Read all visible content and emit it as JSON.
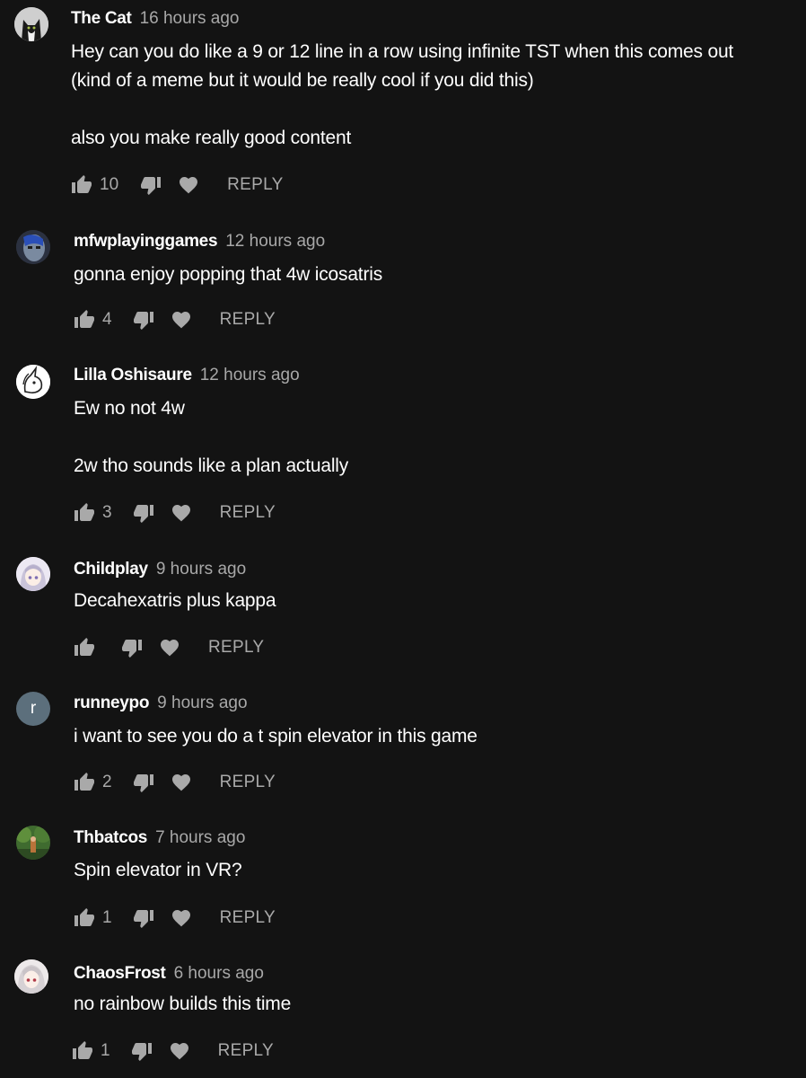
{
  "comments": [
    {
      "author": "The Cat",
      "time": "16 hours ago",
      "lines": [
        "Hey can you do like a 9 or 12 line in a row using infinite TST when this comes out",
        "(kind of a meme but it would be really cool if you did this)",
        "",
        "also you make really good content"
      ],
      "likes": "10",
      "reply": "REPLY",
      "avatar": "black-white-cat"
    },
    {
      "author": "mfwplayinggames",
      "time": "12 hours ago",
      "lines": [
        "gonna enjoy popping that 4w icosatris"
      ],
      "likes": "4",
      "reply": "REPLY",
      "avatar": "blue-face"
    },
    {
      "author": "Lilla Oshisaure",
      "time": "12 hours ago",
      "lines": [
        "Ew no not 4w",
        "",
        "2w tho sounds like a plan actually"
      ],
      "likes": "3",
      "reply": "REPLY",
      "avatar": "line-drawing-unicorn"
    },
    {
      "author": "Childplay",
      "time": "9 hours ago",
      "lines": [
        "Decahexatris plus kappa"
      ],
      "likes": "",
      "reply": "REPLY",
      "avatar": "anime-girl-silver-hair"
    },
    {
      "author": "runneypo",
      "time": "9 hours ago",
      "lines": [
        "i want to see you do a t spin elevator in this game"
      ],
      "likes": "2",
      "reply": "REPLY",
      "avatar": "letter",
      "avatar_letter": "r"
    },
    {
      "author": "Thbatcos",
      "time": "7 hours ago",
      "lines": [
        "Spin elevator in VR?"
      ],
      "likes": "1",
      "reply": "REPLY",
      "avatar": "forest-photo"
    },
    {
      "author": "ChaosFrost",
      "time": "6 hours ago",
      "lines": [
        "no rainbow builds this time"
      ],
      "likes": "1",
      "reply": "REPLY",
      "avatar": "anime-girl-white-hair"
    }
  ],
  "icons": {
    "like": "thumb-up-icon",
    "dislike": "thumb-down-icon",
    "heart": "heart-icon"
  },
  "colors": {
    "background": "#131313",
    "text": "#ffffff",
    "muted": "#a8a8a8"
  }
}
